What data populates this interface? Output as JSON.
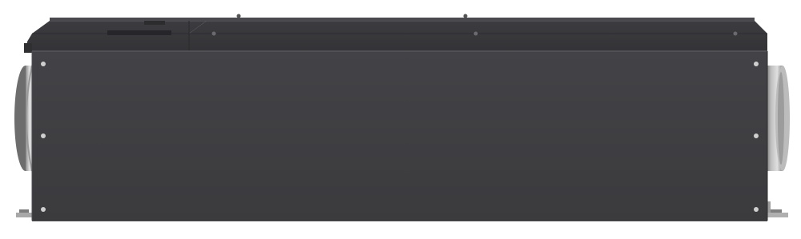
{
  "image": {
    "subject": "ventilation-unit",
    "background": "#ffffff",
    "colors": {
      "body_front": "#404043",
      "body_front_dark": "#37373a",
      "top_panel": "#3a3a3d",
      "top_edge": "#55555a",
      "duct_light": "#d9d9d9",
      "duct_mid": "#a9a9a9",
      "duct_dark": "#6f6f6f",
      "bracket": "#9a9a9a",
      "screw": "#d0d0d0"
    }
  }
}
